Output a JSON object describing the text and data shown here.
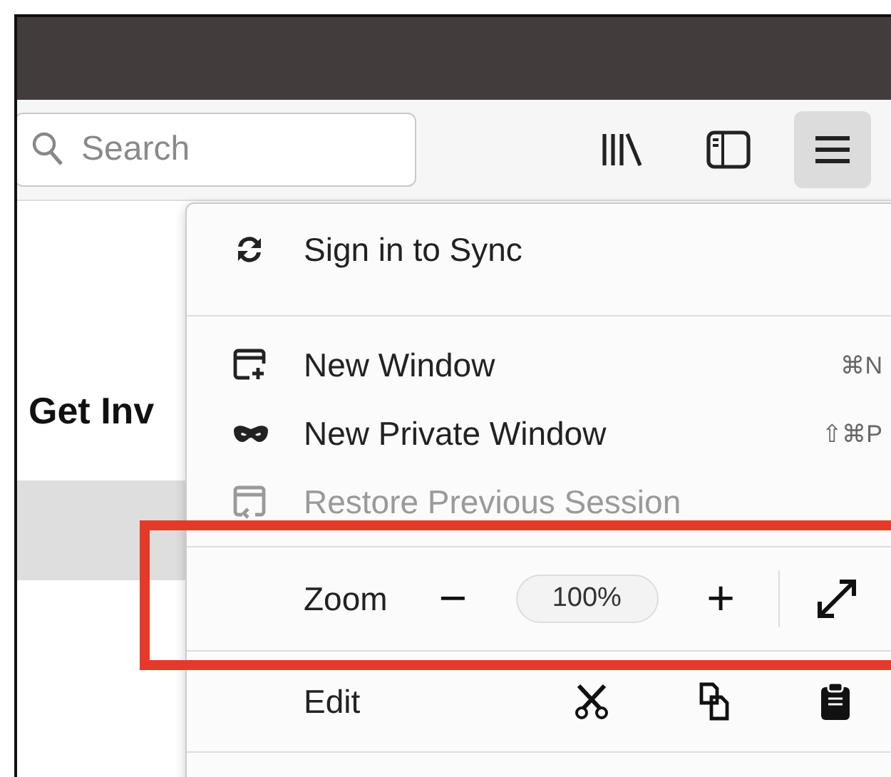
{
  "search": {
    "placeholder": "Search"
  },
  "menu_button": {
    "open": true
  },
  "page": {
    "heading": "Get Inv"
  },
  "menu": {
    "items": [
      {
        "kind": "sync",
        "label": "Sign in to Sync",
        "disabled": false
      },
      {
        "kind": "divider"
      },
      {
        "kind": "window",
        "label": "New Window",
        "shortcut": "⌘N",
        "disabled": false
      },
      {
        "kind": "private",
        "label": "New Private Window",
        "shortcut": "⇧⌘P",
        "disabled": false
      },
      {
        "kind": "restore",
        "label": "Restore Previous Session",
        "disabled": true
      },
      {
        "kind": "divider"
      },
      {
        "kind": "zoom",
        "label": "Zoom",
        "minus": "−",
        "value": "100%",
        "plus": "+",
        "highlighted": true
      },
      {
        "kind": "divider"
      },
      {
        "kind": "edit",
        "label": "Edit"
      },
      {
        "kind": "divider"
      }
    ]
  }
}
